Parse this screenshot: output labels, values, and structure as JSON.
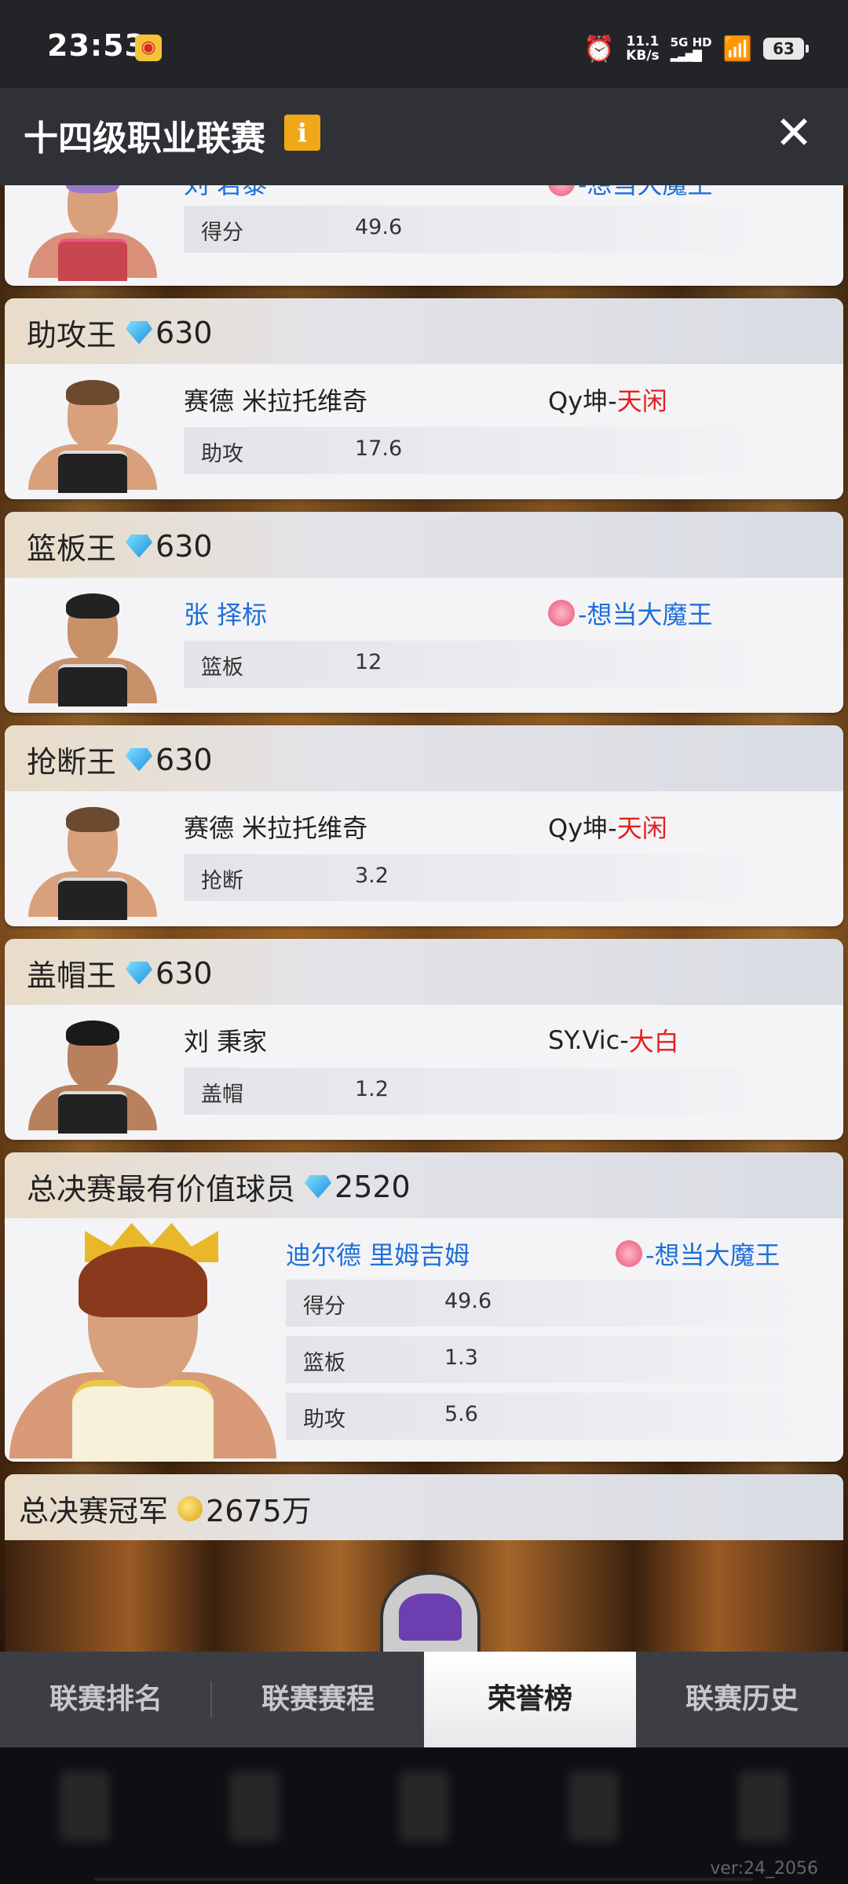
{
  "status": {
    "time": "23:53",
    "speed_value": "11.1",
    "speed_unit": "KB/s",
    "network": "5G HD",
    "battery": "63"
  },
  "header": {
    "title": "十四级职业联赛",
    "info_icon": "i",
    "close_icon": "✕"
  },
  "cards": [
    {
      "title": "",
      "player": "刘 若泰",
      "team_prefix": "",
      "team_name": "-想当大魔王",
      "team_flower": true,
      "stat_label": "得分",
      "stat_value": "49.6"
    },
    {
      "title": "助攻王",
      "reward": "630",
      "player": "赛德 米拉托维奇",
      "team_prefix": "Qy坤-",
      "team_name": "天闲",
      "stat_label": "助攻",
      "stat_value": "17.6"
    },
    {
      "title": "篮板王",
      "reward": "630",
      "player": "张 择标",
      "team_prefix": "",
      "team_name": "-想当大魔王",
      "team_flower": true,
      "stat_label": "篮板",
      "stat_value": "12"
    },
    {
      "title": "抢断王",
      "reward": "630",
      "player": "赛德 米拉托维奇",
      "team_prefix": "Qy坤-",
      "team_name": "天闲",
      "stat_label": "抢断",
      "stat_value": "3.2"
    },
    {
      "title": "盖帽王",
      "reward": "630",
      "player": "刘 秉家",
      "team_prefix": "SY.Vic-",
      "team_name": "大白",
      "stat_label": "盖帽",
      "stat_value": "1.2"
    }
  ],
  "mvp": {
    "title": "总决赛最有价值球员",
    "reward": "2520",
    "player": "迪尔德 里姆吉姆",
    "team_name": "-想当大魔王",
    "stats": [
      {
        "label": "得分",
        "value": "49.6"
      },
      {
        "label": "篮板",
        "value": "1.3"
      },
      {
        "label": "助攻",
        "value": "5.6"
      }
    ]
  },
  "champion": {
    "title": "总决赛冠军",
    "reward": "2675万"
  },
  "tabs": [
    "联赛排名",
    "联赛赛程",
    "荣誉榜",
    "联赛历史"
  ],
  "active_tab": "荣誉榜",
  "version": "ver:24_2056"
}
